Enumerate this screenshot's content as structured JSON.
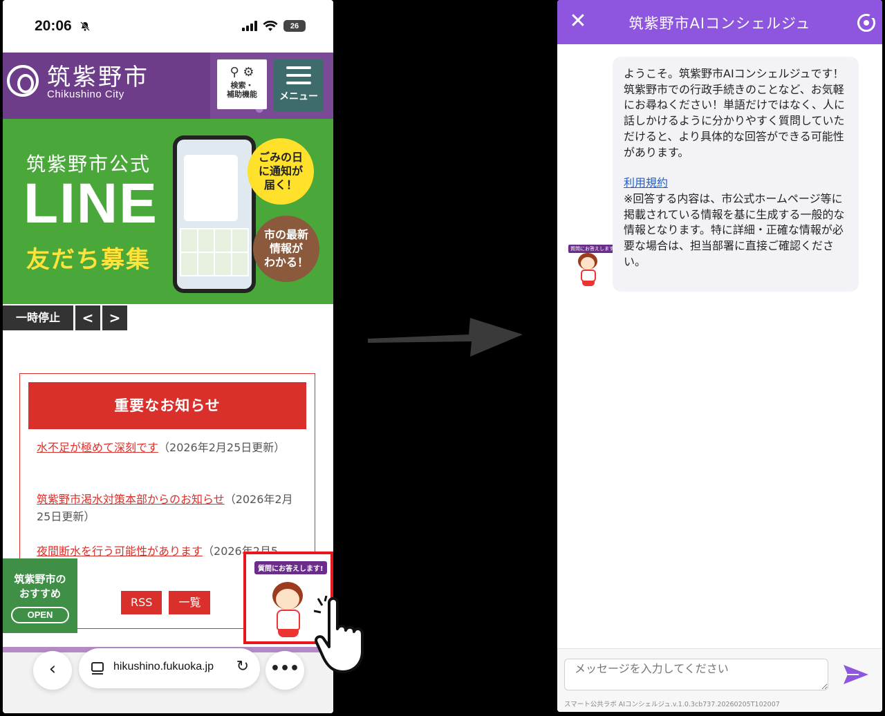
{
  "left_phone": {
    "status": {
      "time": "20:06",
      "battery": "26"
    },
    "header": {
      "city_name": "筑紫野市",
      "city_name_en": "Chikushino City",
      "search_label": "検索・\n補助機能",
      "menu_label": "メニュー"
    },
    "banner": {
      "subtitle": "筑紫野市公式",
      "line": "LINE",
      "friends": "友だち募集",
      "bubble_yellow": "ごみの日\nに通知が\n届く！",
      "bubble_brown": "市の最新\n情報が\nわかる！"
    },
    "slider": {
      "pause": "一時停止",
      "prev": "<",
      "next": ">"
    },
    "notice": {
      "title": "重要なお知らせ",
      "items": [
        {
          "link": "水不足が極めて深刻です",
          "date": "（2026年2月25日更新）"
        },
        {
          "link": "筑紫野市渇水対策本部からのお知らせ",
          "date": "（2026年2月25日更新）"
        },
        {
          "link": "夜間断水を行う可能性があります",
          "date": "（2026年2月5"
        }
      ],
      "rss": "RSS",
      "list": "一覧"
    },
    "recommend": {
      "title": "筑紫野市の\nおすすめ",
      "open": "OPEN"
    },
    "concierge": {
      "tag": "質問にお答えします!"
    },
    "browser": {
      "url": "hikushino.fukuoka.jp",
      "back": "‹",
      "more": "•••"
    }
  },
  "right_phone": {
    "header": {
      "title": "筑紫野市AIコンシェルジュ",
      "close": "✕"
    },
    "avatar_tag": "質問にお答えします!",
    "message": {
      "intro": "ようこそ。筑紫野市AIコンシェルジュです！\n筑紫野市での行政手続きのことなど、お気軽にお尋ねください！単語だけではなく、人に話しかけるように分かりやすく質問していただけると、より具体的な回答ができる可能性があります。",
      "terms_link": "利用規約",
      "disclaimer": "※回答する内容は、市公式ホームページ等に掲載されている情報を基に生成する一般的な情報となります。特に詳細・正確な情報が必要な場合は、担当部署に直接ご確認ください。"
    },
    "input": {
      "placeholder": "メッセージを入力してください"
    },
    "version": "スマート公共ラボ AIコンシェルジュ.v.1.0.3cb737.20260205T102007"
  },
  "colors": {
    "header_purple": "#6e3d8a",
    "banner_green": "#4aa83b",
    "notice_red": "#d9302b",
    "chat_purple": "#8e55de"
  }
}
